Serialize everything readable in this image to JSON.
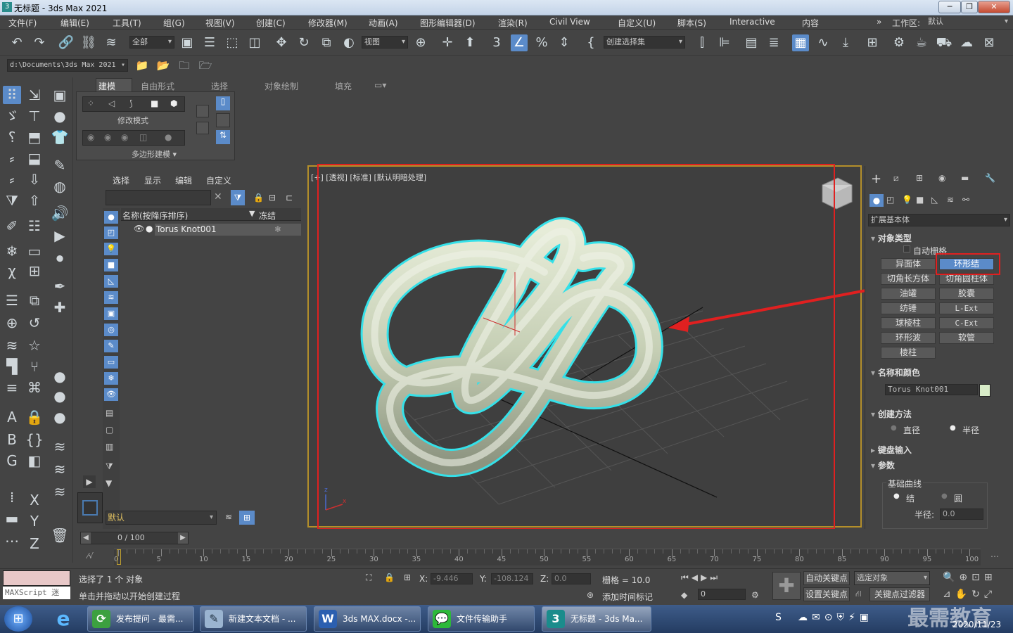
{
  "window": {
    "title": "无标题 - 3ds Max 2021"
  },
  "menu": [
    "文件(F)",
    "编辑(E)",
    "工具(T)",
    "组(G)",
    "视图(V)",
    "创建(C)",
    "修改器(M)",
    "动画(A)",
    "图形编辑器(D)",
    "渲染(R)",
    "Civil View",
    "自定义(U)",
    "脚本(S)",
    "Interactive",
    "内容"
  ],
  "workspace": {
    "label": "工作区:",
    "value": "默认"
  },
  "toolbar": {
    "filter": "全部",
    "ref_coord": "视图",
    "selset": "创建选择集"
  },
  "project_path": "d:\\Documents\\3ds Max 2021",
  "ribbon": {
    "tabs": [
      "建模",
      "自由形式",
      "选择",
      "对象绘制",
      "填充"
    ],
    "mode_label": "修改模式",
    "group_label": "多边形建模"
  },
  "scene_explorer": {
    "menu": [
      "选择",
      "显示",
      "编辑",
      "自定义"
    ],
    "col_name": "名称(按降序排序)",
    "col_freeze": "冻结",
    "object": "Torus Knot001",
    "layer": "默认"
  },
  "viewport": {
    "label": "[+] [透视] [标准] [默认明暗处理]"
  },
  "command_panel": {
    "category": "扩展基本体",
    "rollouts": {
      "object_type": "对象类型",
      "name_color": "名称和颜色",
      "creation_method": "创建方法",
      "keyboard": "键盘输入",
      "params": "参数"
    },
    "autogrid": "自动栅格",
    "buttons": [
      "异面体",
      "环形结",
      "切角长方体",
      "切角圆柱体",
      "油罐",
      "胶囊",
      "纺锤",
      "L-Ext",
      "球棱柱",
      "C-Ext",
      "环形波",
      "软管",
      "棱柱"
    ],
    "selected_button": "环形结",
    "object_name": "Torus Knot001",
    "object_color": "#d8ecc8",
    "method_opts": [
      "直径",
      "半径"
    ],
    "base_curve_label": "基础曲线",
    "curve_opts": [
      "结",
      "圆"
    ],
    "radius_label": "半径:",
    "radius_value": "0.0"
  },
  "timeline": {
    "frame": "0 / 100",
    "ticks": [
      "0",
      "5",
      "10",
      "15",
      "20",
      "25",
      "30",
      "35",
      "40",
      "45",
      "50",
      "55",
      "60",
      "65",
      "70",
      "75",
      "80",
      "85",
      "90",
      "95",
      "100"
    ]
  },
  "status": {
    "maxscript": "MAXScript 迷",
    "selected": "选择了 1 个 对象",
    "prompt": "单击并拖动以开始创建过程",
    "x_label": "X:",
    "x_val": "-9.446",
    "y_label": "Y:",
    "y_val": "-108.124",
    "z_label": "Z:",
    "z_val": "0.0",
    "grid": "栅格 = 10.0",
    "add_time_tag": "添加时间标记",
    "auto_key": "自动关键点",
    "set_key": "设置关键点",
    "selected_obj": "选定对象",
    "key_filter": "关键点过滤器",
    "frame_val": "0"
  },
  "taskbar": {
    "items": [
      "发布提问 - 最需...",
      "新建文本文档 - ...",
      "3ds MAX.docx -...",
      "文件传输助手",
      "无标题 - 3ds Ma..."
    ],
    "date": "2020/11/23",
    "watermark": "最需教育"
  }
}
